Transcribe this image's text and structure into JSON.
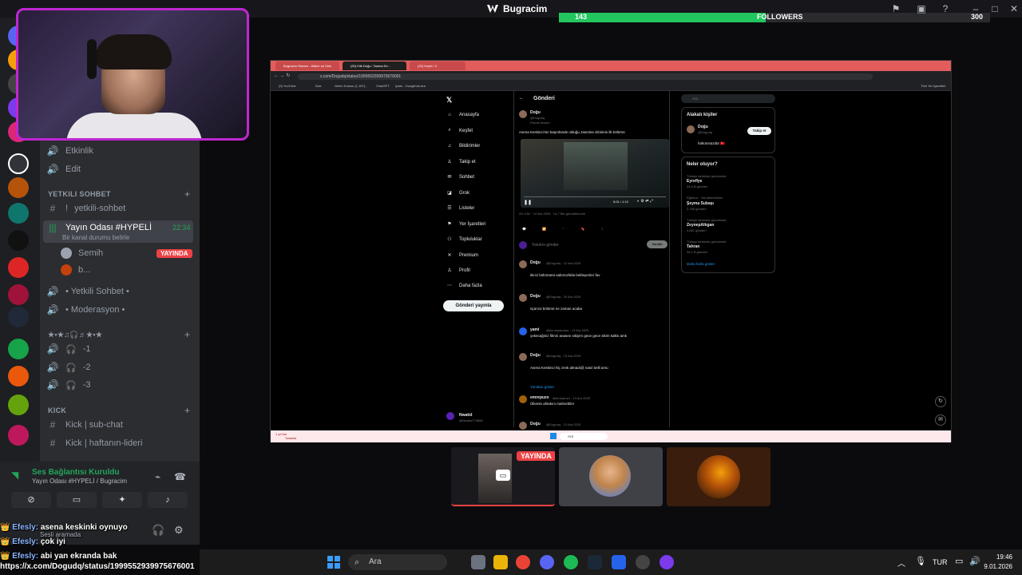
{
  "topbar": {
    "app_title": "Bugracim",
    "followers_current": "143",
    "followers_label": "FOLLOWERS",
    "followers_goal": "300",
    "followers_progress": 0.48
  },
  "channels": {
    "etkinlik": "Etkinlik",
    "edit": "Edit",
    "cat_yetkili": "YETKILI SOHBET",
    "yetkili_sohbet": "yetkili-sohbet",
    "yetkili_prefix": "!",
    "yayin_odasi": "Yayın Odası #HYPELİ",
    "yayin_time": "22:34",
    "yayin_status": "Bir kanal durumu belirle",
    "member1": "Semih",
    "member1_badge": "YAYINDA",
    "member2": "b...",
    "yetkili_voice": "• Yetkili Sohbet •",
    "moderasyon": "• Moderasyon •",
    "cat_music": "★•★♫🎧♬★•★",
    "ch_1": "-1",
    "ch_2": "-2",
    "ch_3": "-3",
    "cat_kick": "KICK",
    "kick_subchat": "Kick  | sub-chat",
    "kick_haftanin": "Kick  | haftanın-lideri"
  },
  "voice": {
    "status": "Ses Bağlantısı Kuruldu",
    "sub": "Yayın Odası #HYPELİ / Bugracim"
  },
  "chat": [
    {
      "user": "Efesly:",
      "text": "asena keskinki oynuyo"
    },
    {
      "user": "",
      "text": "Sesli aramada"
    },
    {
      "user": "Efesly:",
      "text": "çok iyi"
    },
    {
      "user": "Efesly:",
      "text": "abi yan ekranda bak"
    }
  ],
  "status_url": "https://x.com/Dogudq/status/1999552939975676001",
  "browser": {
    "tabs": [
      "Bugracim Stream - Watch on Kick",
      "(20) Kitk Doğu: \"Asena Ke...",
      "(20) Keyfri / X"
    ],
    "url": "x.com/Dogudq/status/1999552939975676001",
    "bookmarks": [
      "(9) YouTube",
      "Kick",
      "Gelen Kutusu (1,167)...",
      "ChatGPT",
      "iyinin - Google'da Ara"
    ],
    "bookmarks_right": "Tüm Yer İşaretleri"
  },
  "xnav": {
    "items": [
      "Anasayfa",
      "Keşfet",
      "Bildirimler",
      "Takip et",
      "Sohbet",
      "Grok",
      "Listeler",
      "Yer İşaretleri",
      "Topluluklar",
      "Premium",
      "Profil",
      "Daha fazla"
    ],
    "post_button": "Gönderi yayınla",
    "account_name": "Nwatid",
    "account_handle": "@Nwatid773858"
  },
  "timeline": {
    "header": "Gönderi",
    "main_author": "Doğu",
    "main_handle": "@Dogudq",
    "main_badge": "Parodi hesabı",
    "main_text": "Asena Keskinci'nin başrolünde olduğu Jasmine dizisinin ilk bölümü",
    "video_time": "0:01 / 1:12",
    "main_date": "Öö 4:52 · 12 Ara 2025 · 14,7 Bin görüntülenme",
    "reply_placeholder": "Yanıtını gönder",
    "reply_button": "Yanıtla",
    "replies": [
      {
        "name": "Doğu",
        "meta": "@Dogudq · 12 Ara 2025",
        "text": "ikinci bölümünü sabırsızlıkla bekleyenler fav"
      },
      {
        "name": "Doğu",
        "meta": "@Dogudq · 20 Ara 2025",
        "text": "üçüncü bölümü ne zaman acaba"
      },
      {
        "name": "yami",
        "meta": "@kurukpanaoto · 13 Ara 2025",
        "text": "çekecağiniz filmin anasını sikiyim gece gece sikim kalktı amk"
      },
      {
        "name": "Doğu",
        "meta": "@Dogudq · 13 Ara 2025",
        "text": "Asena Keskinci hiç zevk almadı@ nasıl belli amu"
      },
      {
        "name": "emrepuzo",
        "meta": "@emrepuzo · 13 Ara 2025",
        "text": "Ülkenin ahlakını mahvettiler"
      },
      {
        "name": "Doğu",
        "meta": "@Dogudq · 13 Ara 2025",
        "text": ""
      }
    ],
    "show_replies": "Yanıtları göster"
  },
  "rightcol": {
    "search": "Ara",
    "people_title": "Alakalı kişiler",
    "person_name": "Doğu",
    "person_handle": "@Dogudq",
    "person_bio": "hökümsüzdür 🇹🇷",
    "follow_button": "Takip et",
    "trends_title": "Neler oluyor?",
    "trends": [
      {
        "ctx": "Türkiye tarihinde gündemde",
        "name": "Eyreflye",
        "count": "44,6 B gönderi"
      },
      {
        "ctx": "Eğlence · Gündemdekiler",
        "name": "Şeyma Subaşı",
        "count": "2,768 gönderi"
      },
      {
        "ctx": "Türkiye tarihinde gündemde",
        "name": "ZeynepAltıgan",
        "count": "4.651 gönderi"
      },
      {
        "ctx": "Türkiye tarihinde gündemde",
        "name": "Tahran",
        "count": "34,1 B gönderi"
      }
    ],
    "show_more": "Daha fazla göster"
  },
  "inner_taskbar": {
    "search": "Ara",
    "notice": "1 yıl kar",
    "notice_sub": "Tamamla"
  },
  "tiles": {
    "tile1_badge": "YAYINDA"
  },
  "taskbar": {
    "search": "Ara",
    "lang": "TUR",
    "time": "19:46",
    "date": "9.01.2026"
  },
  "colors": {
    "accent_live": "#ed4245",
    "follower_bar": "#22c55e",
    "webcam_border": "#c026d3",
    "voice_ok": "#23a55a"
  }
}
